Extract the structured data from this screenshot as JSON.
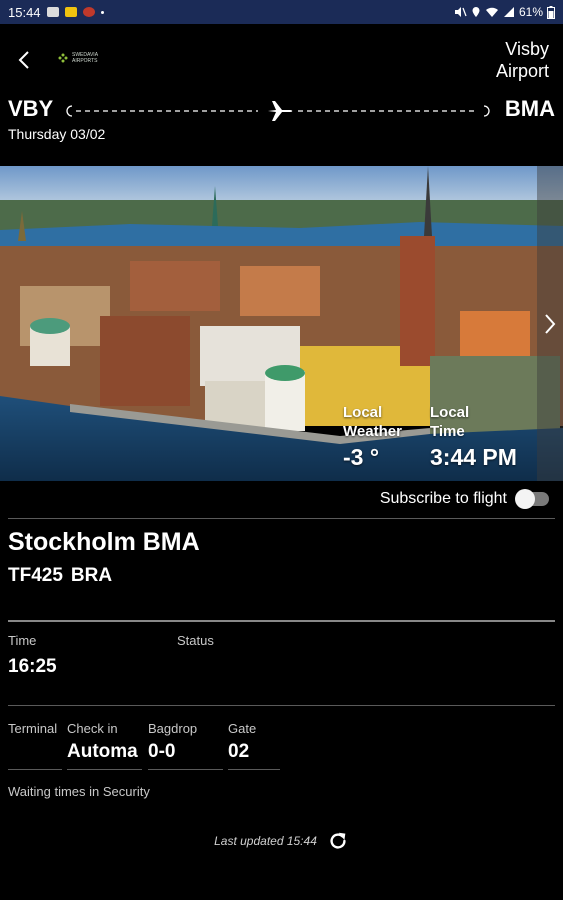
{
  "status_bar": {
    "time": "15:44",
    "battery": "61%"
  },
  "header": {
    "airport_title_line1": "Visby",
    "airport_title_line2": "Airport",
    "logo_text": "SWEDAVIA AIRPORTS"
  },
  "route": {
    "from": "VBY",
    "to": "BMA",
    "date": "Thursday 03/02"
  },
  "hero": {
    "weather_label_1": "Local",
    "weather_label_2": "Weather",
    "weather_value": "-3 °",
    "time_label_1": "Local",
    "time_label_2": "Time",
    "time_value": "3:44 PM"
  },
  "subscribe": {
    "label": "Subscribe to flight",
    "enabled": false
  },
  "flight": {
    "destination": "Stockholm BMA",
    "flight_number": "TF425",
    "airline_code": "BRA"
  },
  "details": {
    "time_label": "Time",
    "time_value": "16:25",
    "status_label": "Status",
    "status_value": "",
    "terminal_label": "Terminal",
    "terminal_value": "",
    "checkin_label": "Check in",
    "checkin_value": "Automa",
    "bagdrop_label": "Bagdrop",
    "bagdrop_value": "0-0",
    "gate_label": "Gate",
    "gate_value": "02"
  },
  "security": {
    "label": "Waiting times in Security"
  },
  "footer": {
    "last_updated": "Last updated 15:44"
  },
  "colors": {
    "status_bar": "#1b2b57",
    "background": "#000000"
  }
}
